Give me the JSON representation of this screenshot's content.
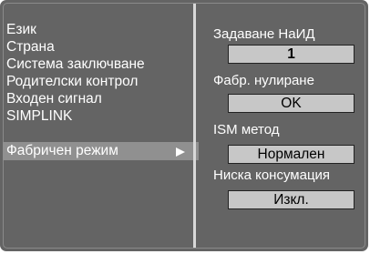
{
  "menu": {
    "items": [
      {
        "label": "Език"
      },
      {
        "label": "Страна"
      },
      {
        "label": "Система заключване"
      },
      {
        "label": "Родителски контрол"
      },
      {
        "label": "Входен сигнал"
      },
      {
        "label": "SIMPLINK"
      },
      {
        "label": "Фабричен режим",
        "selected": true
      }
    ]
  },
  "factory_mode": {
    "set_id": {
      "label": "Задаване НаИД",
      "value": "1"
    },
    "factory_reset": {
      "label": "Фабр. нулиране",
      "value": "OK"
    },
    "ism_method": {
      "label": "ISM метод",
      "value": "Нормален"
    },
    "low_power": {
      "label": "Ниска консумация",
      "value": "Изкл."
    }
  },
  "colors": {
    "background": "#646464",
    "selected_row": "#909090",
    "value_box": "#c7c7c7",
    "text": "#ffffff"
  }
}
